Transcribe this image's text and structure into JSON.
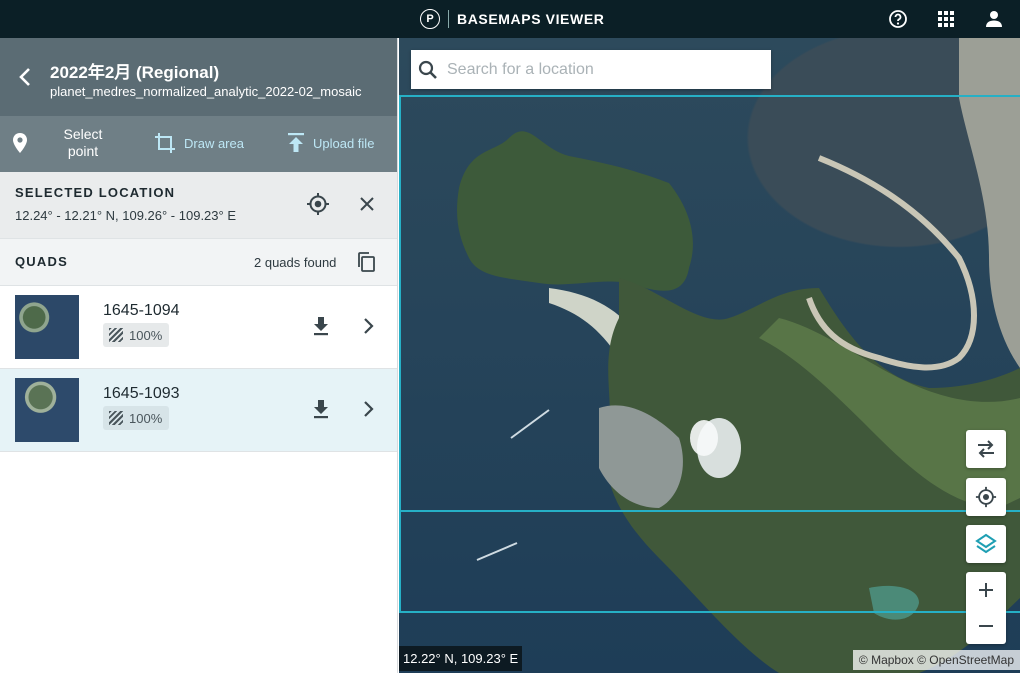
{
  "app": {
    "logo_letter": "P",
    "title": "BASEMAPS VIEWER"
  },
  "icons": {
    "help": "help-circle-icon",
    "apps": "apps-grid-icon",
    "account": "account-icon"
  },
  "panel": {
    "mosaic_title": "2022年2月 (Regional)",
    "mosaic_name": "planet_medres_normalized_analytic_2022-02_mosaic"
  },
  "tools": {
    "select_point": "Select point",
    "draw_area": "Draw area",
    "upload_file": "Upload file"
  },
  "selected_location": {
    "title": "SELECTED LOCATION",
    "coords": "12.24° - 12.21° N, 109.26° - 109.23° E"
  },
  "quads": {
    "title": "QUADS",
    "count": "2 quads found",
    "items": [
      {
        "id": "1645-1094",
        "coverage": "100%"
      },
      {
        "id": "1645-1093",
        "coverage": "100%"
      }
    ]
  },
  "map": {
    "search_placeholder": "Search for a location",
    "coord_readout": "12.22° N, 109.23° E",
    "attribution": "© Mapbox © OpenStreetMap"
  },
  "colors": {
    "topbar": "#0b1f26",
    "panel_header": "#5b6c74",
    "tools_bar": "#6f7f86",
    "accent": "#26b0c6",
    "active_row": "#e6f3f7"
  }
}
